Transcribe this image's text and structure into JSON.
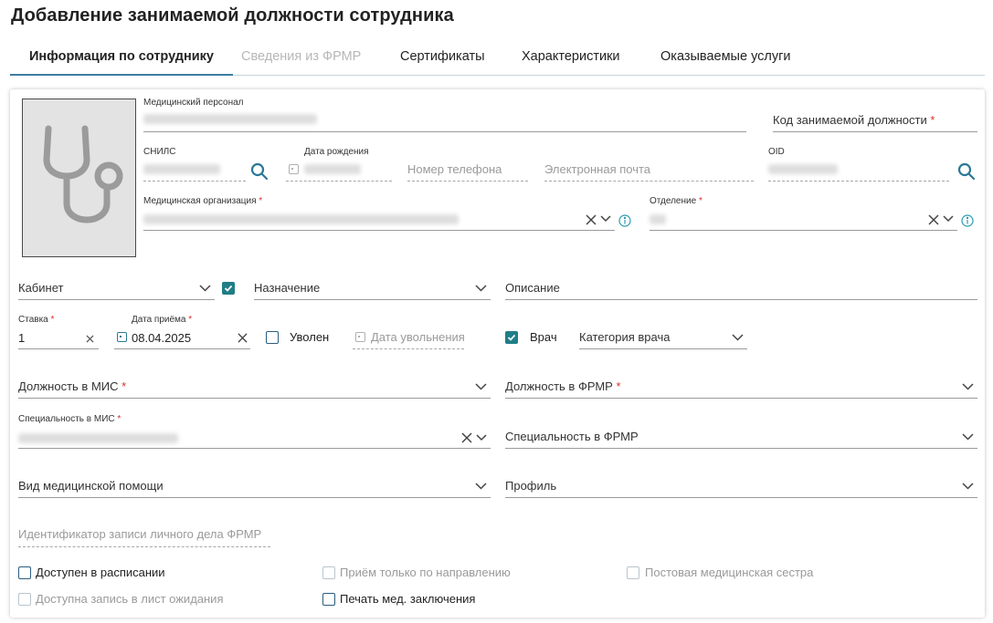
{
  "title": "Добавление занимаемой должности сотрудника",
  "tabs": [
    {
      "label": "Информация по сотруднику"
    },
    {
      "label": "Сведения из ФРМР"
    },
    {
      "label": "Сертификаты"
    },
    {
      "label": "Характеристики"
    },
    {
      "label": "Оказываемые услуги"
    }
  ],
  "personnel": {
    "label": "Медицинский персонал",
    "value": ""
  },
  "position_code": {
    "placeholder": "Код занимаемой должности",
    "required": "*"
  },
  "snils": {
    "label": "СНИЛС",
    "value": ""
  },
  "birth_date": {
    "label": "Дата рождения",
    "value": ""
  },
  "phone": {
    "placeholder": "Номер телефона"
  },
  "email": {
    "placeholder": "Электронная почта"
  },
  "oid": {
    "label": "OID",
    "value": ""
  },
  "med_org": {
    "label": "Медицинская организация",
    "required": "*",
    "value": ""
  },
  "department": {
    "label": "Отделение",
    "required": "*",
    "value": ""
  },
  "cabinet": {
    "placeholder": "Кабинет"
  },
  "purpose": {
    "placeholder": "Назначение"
  },
  "description": {
    "placeholder": "Описание"
  },
  "rate": {
    "label": "Ставка",
    "required": "*",
    "value": "1"
  },
  "hire_date": {
    "label": "Дата приёма",
    "required": "*",
    "value": "08.04.2025"
  },
  "dismissed": {
    "label": "Уволен",
    "checked": false
  },
  "dismissal_date": {
    "placeholder": "Дата увольнения"
  },
  "doctor": {
    "label": "Врач",
    "checked": true
  },
  "doctor_category": {
    "placeholder": "Категория врача"
  },
  "mis_position": {
    "placeholder": "Должность в МИС",
    "required": "*"
  },
  "frmr_position": {
    "placeholder": "Должность в ФРМР",
    "required": "*"
  },
  "mis_specialty": {
    "label": "Специальность в МИС",
    "required": "*",
    "value": ""
  },
  "frmr_specialty": {
    "placeholder": "Специальность в ФРМР"
  },
  "care_type": {
    "placeholder": "Вид медицинской помощи"
  },
  "profile": {
    "placeholder": "Профиль"
  },
  "frmr_record_id": {
    "placeholder": "Идентификатор записи личного дела ФРМР"
  },
  "checkboxes": {
    "schedule": {
      "label": "Доступен в расписании",
      "checked": false
    },
    "referral_only": {
      "label": "Приём только по направлению",
      "checked": false
    },
    "ward_nurse": {
      "label": "Постовая медицинская сестра",
      "checked": false
    },
    "waitlist": {
      "label": "Доступна запись в лист ожидания",
      "checked": false
    },
    "print_conclusion": {
      "label": "Печать мед. заключения",
      "checked": false
    }
  },
  "colors": {
    "accent": "#3b7ea1",
    "checkbox_checked": "#1f7e87",
    "required": "#d9302a",
    "info": "#2a9bb0"
  },
  "icons": {
    "photo": "stethoscope-icon",
    "search": "search-icon",
    "clear": "close-icon",
    "dropdown": "chevron-down-icon",
    "info": "info-icon",
    "calendar": "calendar-icon"
  }
}
